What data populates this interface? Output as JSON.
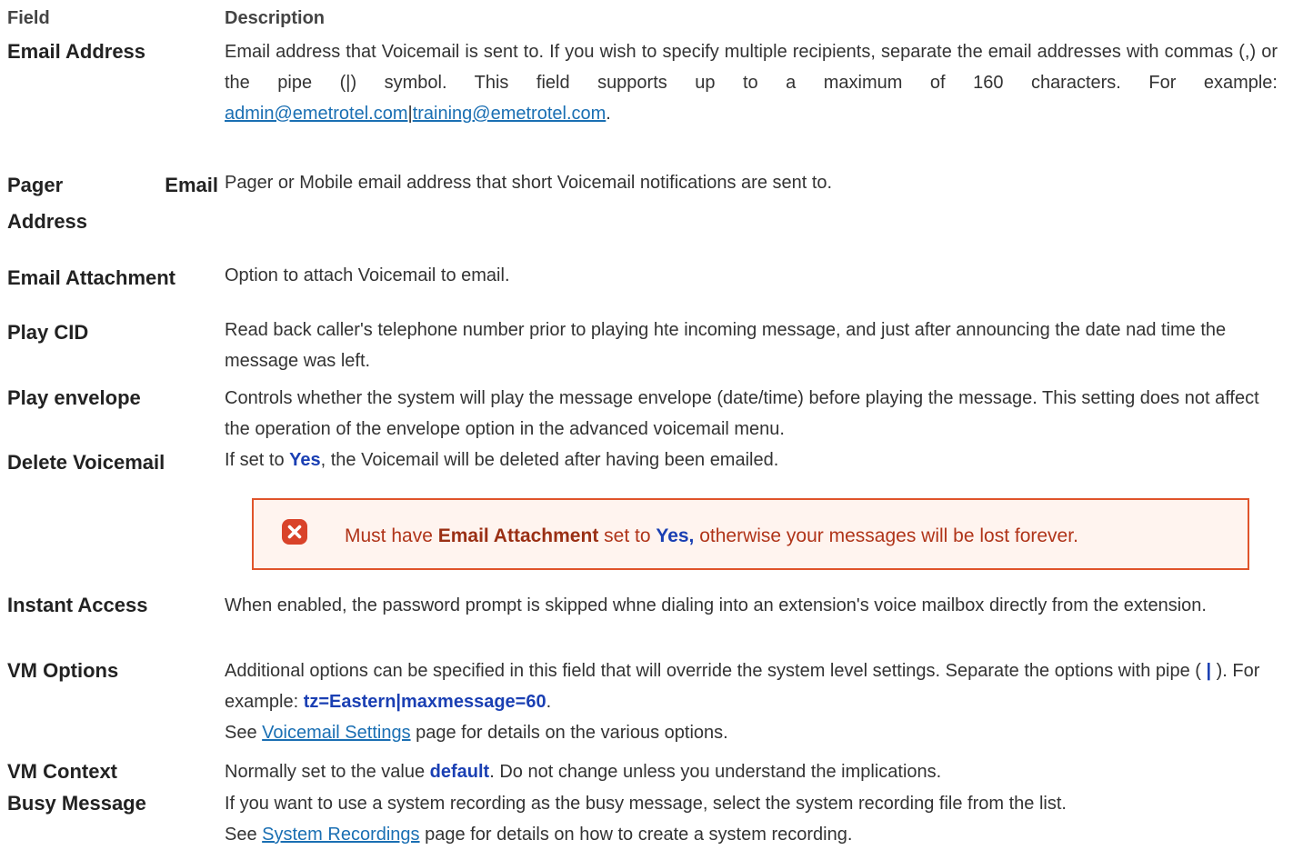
{
  "header": {
    "field": "Field",
    "description": "Description"
  },
  "rows": {
    "email_address": {
      "field": "Email Address",
      "desc_text": "Email address that Voicemail is sent to. If you wish to specify multiple recipients, separate the email addresses with commas (,) or the pipe (|) symbol. This field supports up to a maximum of 160 characters. For example: ",
      "link1": "admin@emetrotel.com",
      "sep": "|",
      "link2": "training@emetrotel.com",
      "end": "."
    },
    "pager_email": {
      "field_line1": "Pager Email",
      "field_line2": "Address",
      "desc": "Pager or Mobile email address that short Voicemail notifications are sent to."
    },
    "email_attachment": {
      "field": "Email Attachment",
      "desc": "Option to attach Voicemail to email."
    },
    "play_cid": {
      "field": "Play CID",
      "desc": "Read back caller's telephone number prior to playing hte incoming message, and just after announcing the date nad time the message was left."
    },
    "play_envelope": {
      "field": "Play envelope",
      "desc": "Controls whether the system will play the message envelope (date/time) before playing the message. This setting does not affect the operation of the envelope option in the advanced voicemail menu."
    },
    "delete_voicemail": {
      "field": "Delete Voicemail",
      "desc_pre": "If set to ",
      "desc_kw": "Yes",
      "desc_post": ", the Voicemail will be deleted after having been emailed."
    },
    "instant_access": {
      "field": "Instant Access",
      "desc": "When enabled, the password prompt is skipped whne dialing into an extension's voice mailbox directly from the extension."
    },
    "vm_options": {
      "field": "VM Options",
      "desc_pre": "Additional options can be specified in this field that will override the system level settings. Separate the options with pipe ( ",
      "pipe": "|",
      "desc_mid": " ). For example: ",
      "example": "tz=Eastern|maxmessage=60",
      "desc_end": ".",
      "see_pre": "See ",
      "see_link": "Voicemail Settings",
      "see_post": " page for details on the various options."
    },
    "vm_context": {
      "field": "VM Context",
      "desc_pre": "Normally set to the value ",
      "desc_kw": "default",
      "desc_post": ". Do not change unless you understand the implications."
    },
    "busy_message": {
      "field": "Busy Message",
      "desc": "If you want to use a system recording as the busy message, select the system recording file from the list.",
      "see_pre": "See ",
      "see_link": "System Recordings",
      "see_post": " page for details on how to create a system recording."
    }
  },
  "alert": {
    "icon": "error-x-icon",
    "pre": "Must have ",
    "strong": "Email Attachment",
    "mid": " set to ",
    "kw": "Yes,",
    "post": " otherwise your messages will be lost forever.",
    "border_color": "#e0542b",
    "text_color": "#b03419"
  }
}
